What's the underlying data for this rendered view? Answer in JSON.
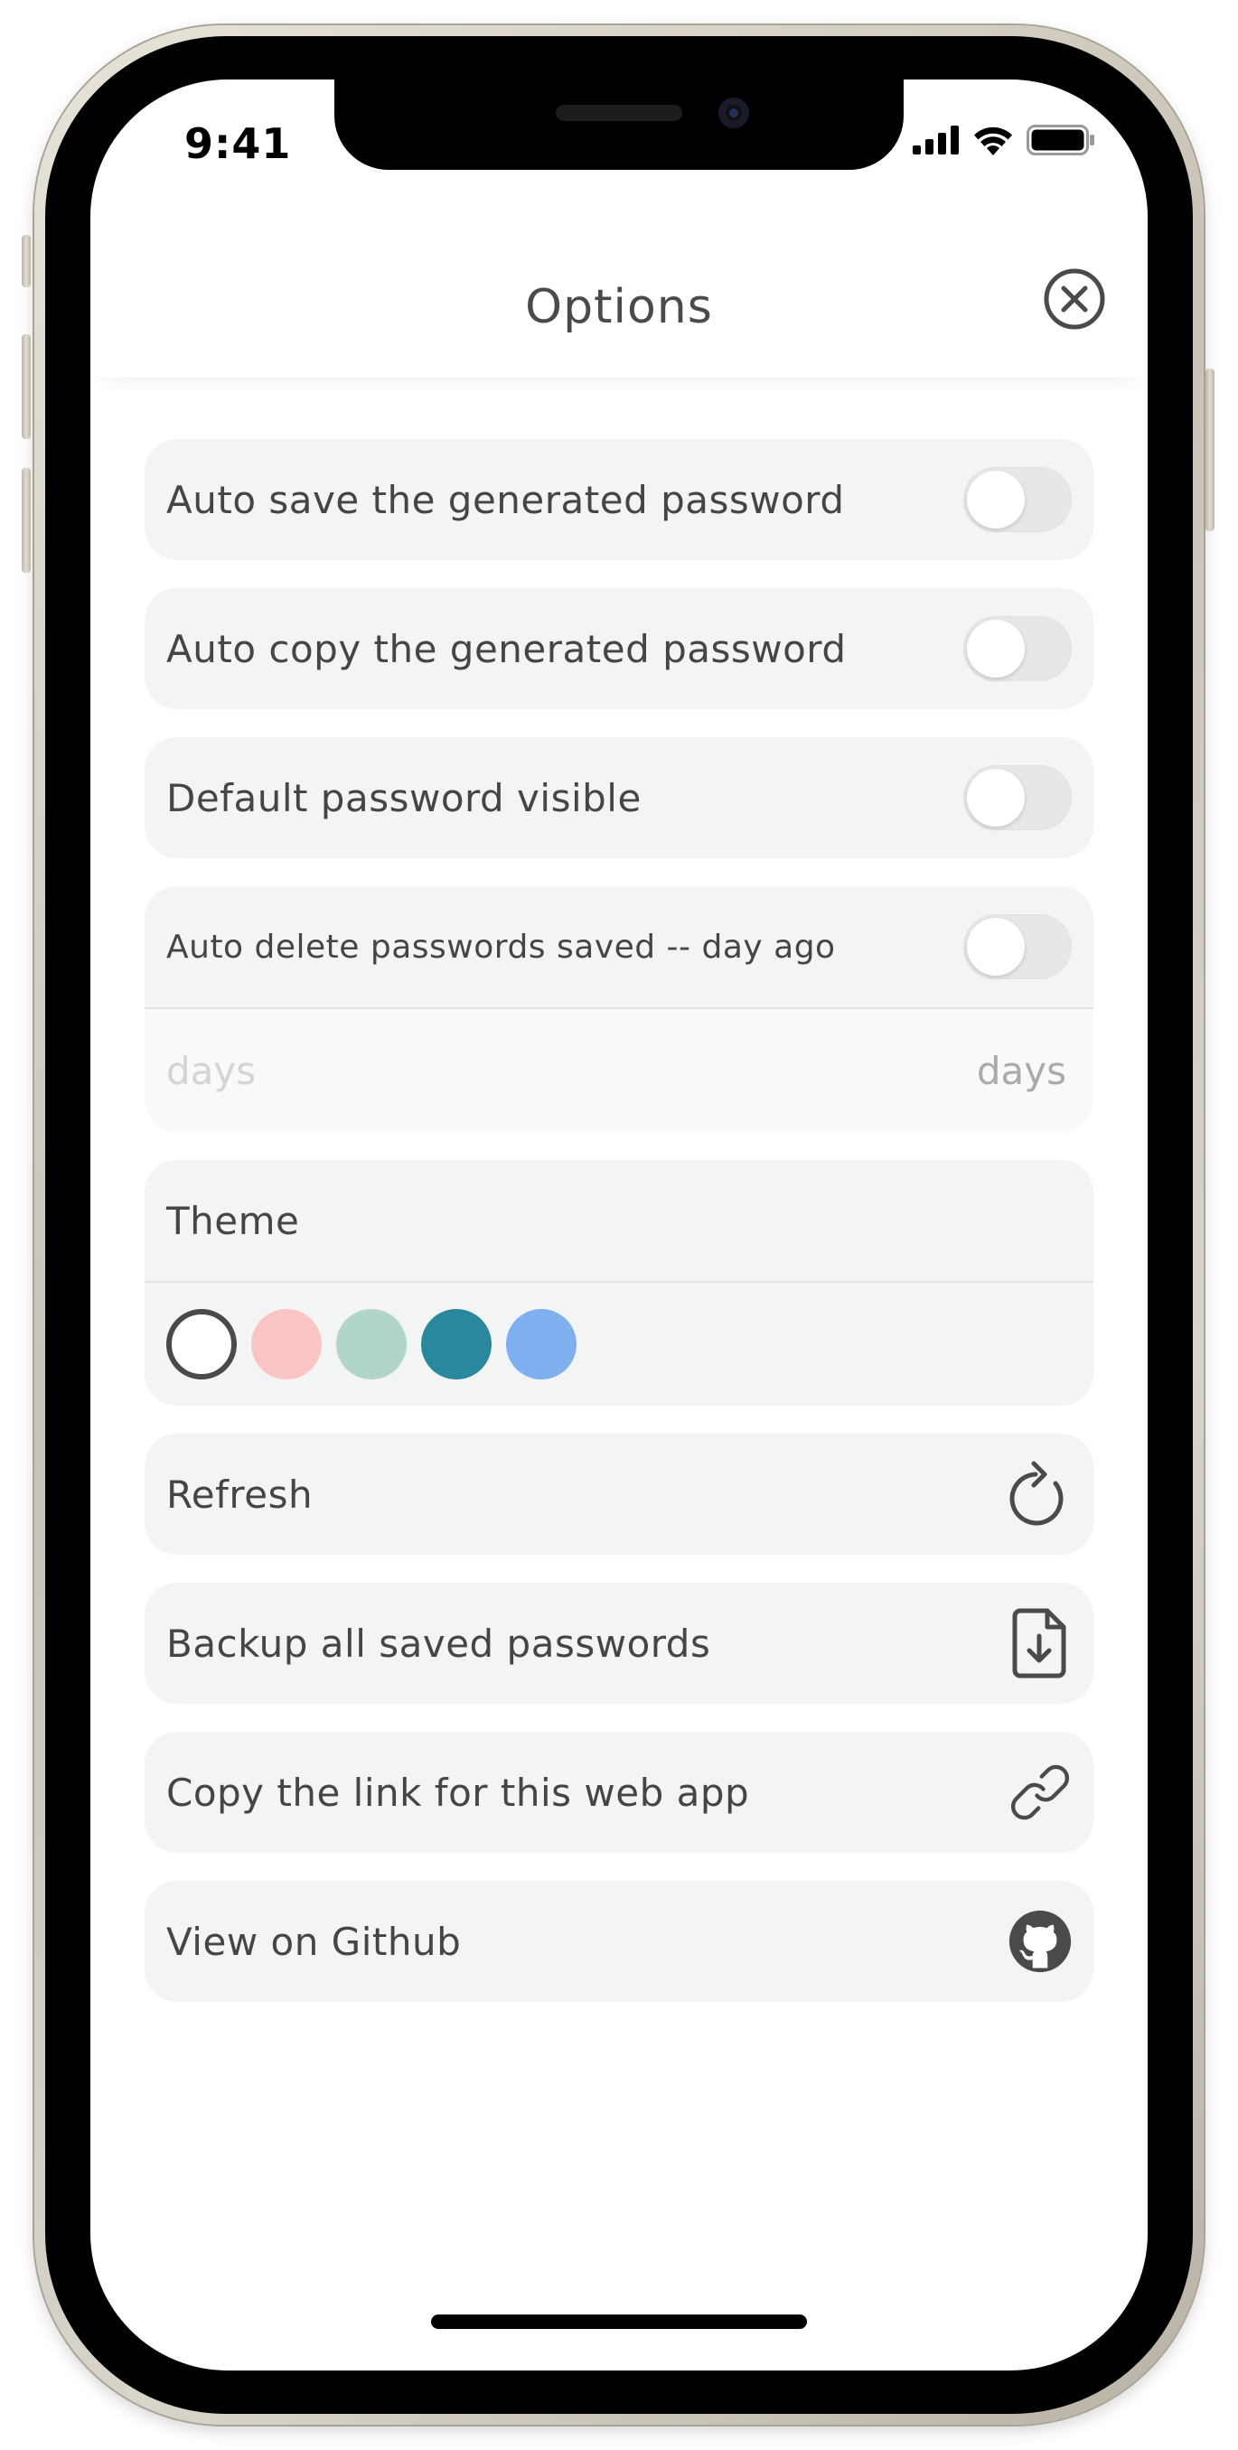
{
  "status": {
    "time": "9:41"
  },
  "header": {
    "title": "Options"
  },
  "options": {
    "auto_save": {
      "label": "Auto save the generated password",
      "enabled": false
    },
    "auto_copy": {
      "label": "Auto copy the generated password",
      "enabled": false
    },
    "default_visible": {
      "label": "Default password visible",
      "enabled": false
    },
    "auto_delete": {
      "label": "Auto delete passwords saved -- day ago",
      "enabled": false,
      "days_placeholder": "days",
      "days_unit": "days"
    }
  },
  "theme": {
    "label": "Theme",
    "swatches": [
      {
        "name": "white",
        "color": "#ffffff",
        "selected": true
      },
      {
        "name": "pink",
        "color": "#f8c4c4"
      },
      {
        "name": "mint",
        "color": "#b1d6c8"
      },
      {
        "name": "teal",
        "color": "#2a889d"
      },
      {
        "name": "blue",
        "color": "#7eb0f0"
      }
    ]
  },
  "actions": {
    "refresh": {
      "label": "Refresh",
      "icon": "refresh-icon"
    },
    "backup": {
      "label": "Backup all saved passwords",
      "icon": "file-download-icon"
    },
    "copy_link": {
      "label": "Copy the link for this web app",
      "icon": "link-icon"
    },
    "github": {
      "label": "View on Github",
      "icon": "github-icon"
    }
  },
  "colors": {
    "text": "#454545",
    "row_bg": "#f3f4f4",
    "icon": "#4a4a4a"
  }
}
